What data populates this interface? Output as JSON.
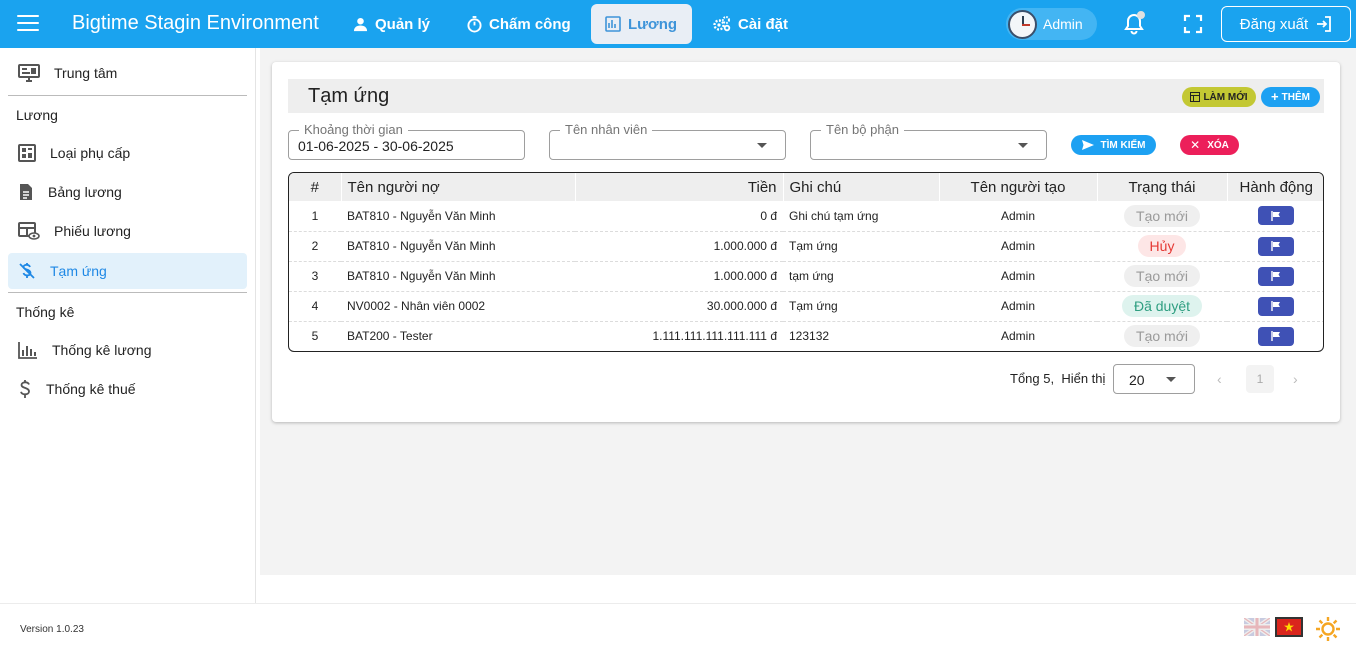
{
  "app": {
    "title": "Bigtime Stagin Environment"
  },
  "nav": {
    "items": [
      {
        "label": "Quản lý",
        "icon": "person-icon"
      },
      {
        "label": "Chấm công",
        "icon": "stopwatch-icon"
      },
      {
        "label": "Lương",
        "icon": "ledger-icon",
        "active": true
      },
      {
        "label": "Cài đặt",
        "icon": "gears-icon"
      }
    ],
    "user_label": "Admin",
    "logout_label": "Đăng xuất"
  },
  "sidebar": {
    "home_label": "Trung tâm",
    "section_salary": "Lương",
    "salary_items": [
      {
        "label": "Loại phụ cấp",
        "icon": "dashboard-icon"
      },
      {
        "label": "Bảng lương",
        "icon": "document-icon"
      },
      {
        "label": "Phiếu lương",
        "icon": "table-eye-icon"
      },
      {
        "label": "Tạm ứng",
        "icon": "money-off-icon",
        "active": true
      }
    ],
    "section_stats": "Thống kê",
    "stats_items": [
      {
        "label": "Thống kê lương",
        "icon": "bar-chart-icon"
      },
      {
        "label": "Thống kê thuế",
        "icon": "dollar-icon"
      }
    ]
  },
  "page": {
    "title": "Tạm ứng",
    "refresh_label": "LÀM MỚI",
    "add_label": "THÊM",
    "filters": {
      "date_label": "Khoảng thời gian",
      "date_value": "01-06-2025 - 30-06-2025",
      "employee_label": "Tên nhân viên",
      "department_label": "Tên bộ phận"
    },
    "search_label": "TÌM KIẾM",
    "clear_label": "XÓA"
  },
  "table": {
    "headers": [
      "#",
      "Tên người nợ",
      "Tiền",
      "Ghi chú",
      "Tên người tạo",
      "Trạng thái",
      "Hành động"
    ],
    "rows": [
      {
        "no": "1",
        "debtor": "BAT810 - Nguyễn Văn Minh",
        "amount": "0 đ",
        "note": "Ghi chú tạm ứng",
        "creator": "Admin",
        "status": "Tạo mới",
        "status_type": "new"
      },
      {
        "no": "2",
        "debtor": "BAT810 - Nguyễn Văn Minh",
        "amount": "1.000.000 đ",
        "note": "Tạm ứng",
        "creator": "Admin",
        "status": "Hủy",
        "status_type": "cancel"
      },
      {
        "no": "3",
        "debtor": "BAT810 - Nguyễn Văn Minh",
        "amount": "1.000.000 đ",
        "note": "tạm ứng",
        "creator": "Admin",
        "status": "Tạo mới",
        "status_type": "new"
      },
      {
        "no": "4",
        "debtor": "NV0002 - Nhân viên 0002",
        "amount": "30.000.000 đ",
        "note": "Tạm ứng",
        "creator": "Admin",
        "status": "Đã duyệt",
        "status_type": "approved"
      },
      {
        "no": "5",
        "debtor": "BAT200 - Tester",
        "amount": "1.111.111.111.111.111 đ",
        "note": "123132",
        "creator": "Admin",
        "status": "Tạo mới",
        "status_type": "new"
      }
    ]
  },
  "pagination": {
    "total_text": "Tổng 5,",
    "show_label": "Hiển thị",
    "page_size": "20",
    "current_page": "1",
    "prev_symbol": "‹",
    "next_symbol": "›"
  },
  "footer": {
    "version": "Version 1.0.23"
  },
  "colors": {
    "primary": "#1aa3ef",
    "refresh_button": "#c3c833",
    "clear_button": "#ec1f5a",
    "action_button": "#3f51b5"
  }
}
